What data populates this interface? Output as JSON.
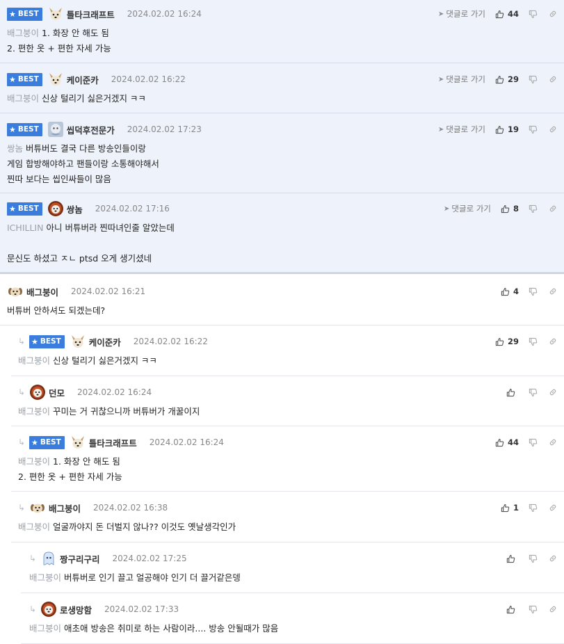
{
  "labels": {
    "best": "BEST",
    "goto_reply": "댓글로 가기"
  },
  "colors": {
    "best_badge": "#3b7ddd",
    "best_bg": "#eef3fb",
    "mention": "#9aa0a8"
  },
  "comments": [
    {
      "best": true,
      "nick": "틀타크래프트",
      "date": "2024.02.02 16:24",
      "likes": "44",
      "mention": "배그붕이",
      "lines": [
        "1. 화장 안 해도 됨",
        "2. 편한 옷 + 편한 자세 가능"
      ],
      "avatar": "dog-avatar-icon"
    },
    {
      "best": true,
      "nick": "케이준카",
      "date": "2024.02.02 16:22",
      "likes": "29",
      "mention": "배그붕이",
      "lines": [
        "신상 털리기 싫은거겠지 ㅋㅋ"
      ],
      "avatar": "dog-avatar-icon"
    },
    {
      "best": true,
      "nick": "씹덕후전문가",
      "date": "2024.02.02 17:23",
      "likes": "19",
      "mention": "쌍놈",
      "lines": [
        "버튜버도 결국 다른 방송인들이랑",
        "게임 합방해야하고 팬들이랑 소통해야해서",
        "찐따 보다는 씹인싸들이 많음"
      ],
      "avatar": "character-avatar-icon"
    },
    {
      "best": true,
      "nick": "쌍놈",
      "date": "2024.02.02 17:16",
      "likes": "8",
      "mention": "ICHILLIN",
      "lines": [
        "아니 버튜버라 찐따녀인줄 알았는데",
        "",
        "문신도 하셨고 ㅈㄴ ptsd 오게 생기셨네"
      ],
      "avatar": "lion-avatar-icon"
    },
    {
      "best": false,
      "nick": "배그붕이",
      "date": "2024.02.02 16:21",
      "likes": "4",
      "mention": "",
      "lines": [
        "버튜버 안하셔도 되겠는데?"
      ],
      "avatar": "pup-avatar-icon"
    },
    {
      "best": true,
      "reply": true,
      "nick": "케이준카",
      "date": "2024.02.02 16:22",
      "likes": "29",
      "mention": "배그붕이",
      "lines": [
        "신상 털리기 싫은거겠지 ㅋㅋ"
      ],
      "avatar": "dog-avatar-icon"
    },
    {
      "best": false,
      "reply": true,
      "nick": "던모",
      "date": "2024.02.02 16:24",
      "likes": "",
      "mention": "배그붕이",
      "lines": [
        "꾸미는 거 귀찮으니까 버튜버가 개꿀이지"
      ],
      "avatar": "lion-avatar-icon"
    },
    {
      "best": true,
      "reply": true,
      "nick": "틀타크래프트",
      "date": "2024.02.02 16:24",
      "likes": "44",
      "mention": "배그붕이",
      "lines": [
        "1. 화장 안 해도 됨",
        "2. 편한 옷 + 편한 자세 가능"
      ],
      "avatar": "dog-avatar-icon"
    },
    {
      "best": false,
      "reply": true,
      "nick": "배그붕이",
      "date": "2024.02.02 16:38",
      "likes": "1",
      "mention": "배그붕이",
      "lines": [
        "얼굴까야지 돈 더벌지 않나?? 이것도 옛날생각인가"
      ],
      "avatar": "pup-avatar-icon"
    },
    {
      "best": false,
      "reply": true,
      "nick": "짱구리구리",
      "date": "2024.02.02 17:25",
      "likes": "",
      "mention": "배그붕이",
      "lines": [
        "버튜버로 인기 끌고 얼공해야 인기 더 끌거같은뎅"
      ],
      "avatar": "ghost-avatar-icon"
    },
    {
      "best": false,
      "reply": true,
      "nick": "로생망함",
      "date": "2024.02.02 17:33",
      "likes": "",
      "mention": "배그붕이",
      "lines": [
        "애초애 방송은 취미로 하는 사람이라.... 방송 안될때가 많음"
      ],
      "avatar": "lion-avatar-icon"
    }
  ]
}
